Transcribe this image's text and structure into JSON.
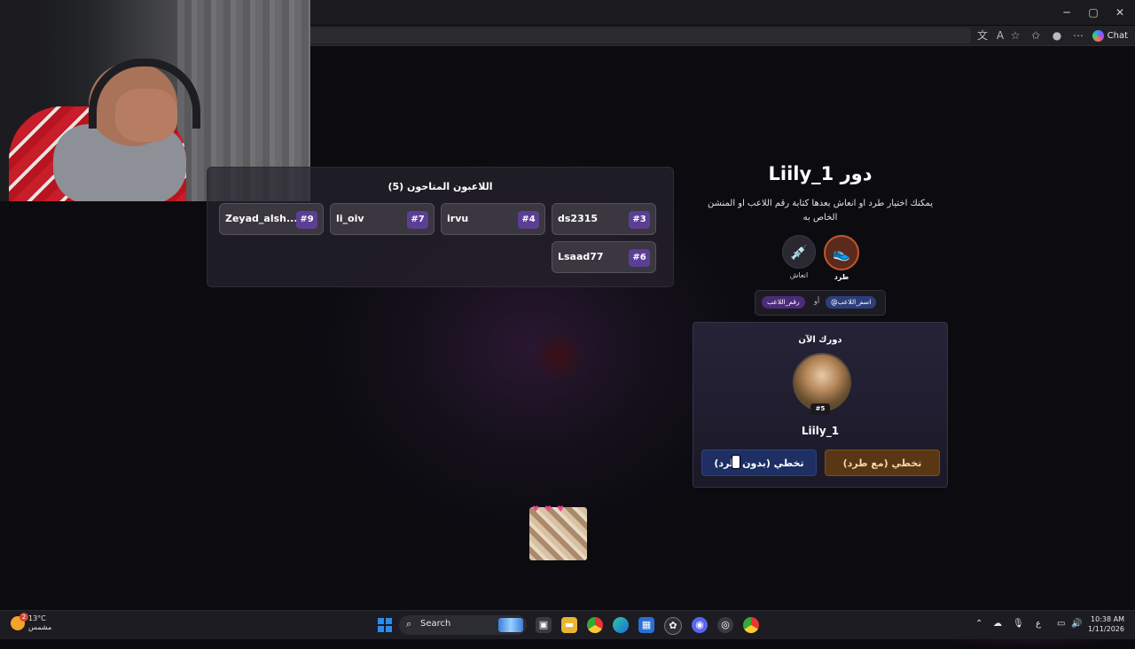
{
  "browser": {
    "chat_label": "Chat",
    "window_controls": [
      "─",
      "▢",
      "✕"
    ]
  },
  "players_panel": {
    "title": "اللاعبون المتاحون (5)",
    "players": [
      {
        "name": "ds2315",
        "number": "#3"
      },
      {
        "name": "irvu",
        "number": "#4"
      },
      {
        "name": "li_oiv",
        "number": "#7"
      },
      {
        "name": "Zeyad_alsh...",
        "number": "#9"
      },
      {
        "name": "Lsaad77",
        "number": "#6"
      }
    ]
  },
  "turn": {
    "title": "دور Liily_1",
    "description": "يمكنك اختيار طرد او انعاش بعدها كتابة رقم اللاعب او المنشن الخاص به",
    "actions": [
      {
        "label": "طرد",
        "icon": "shoe-icon"
      },
      {
        "label": "انعاش",
        "icon": "syringe-icon"
      }
    ],
    "tags": {
      "name_tag": "@اسم_اللاعب",
      "or_text": "أو",
      "number_tag": "رقم_اللاعب"
    }
  },
  "now_turn": {
    "label": "دورك الآن",
    "player_name": "Liily_1",
    "player_badge": "#5",
    "skip_without_kick": "تخطي (بدون طرد)",
    "skip_with_kick": "تخطي (مع طرد)"
  },
  "taskbar": {
    "weather_temp": "13°C",
    "weather_desc": "مشمس",
    "weather_badge": "2",
    "search_label": "Search",
    "lang": "ع",
    "time": "10:38 AM",
    "date": "1/11/2026"
  },
  "colors": {
    "accent_purple": "#5b3f95",
    "no_kick_button": "#1d2f63",
    "kick_button": "#5a3714"
  }
}
